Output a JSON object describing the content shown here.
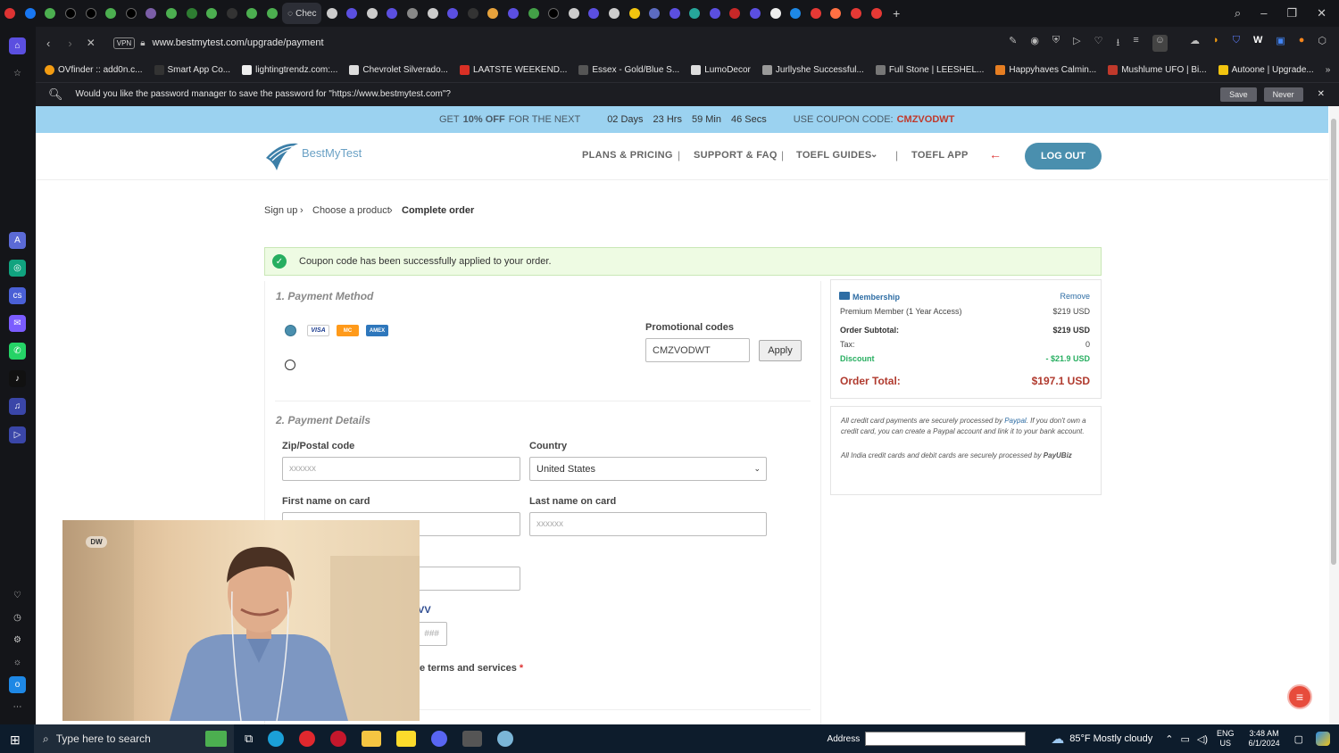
{
  "browser": {
    "active_tab_label": "Chec",
    "url": "www.bestmytest.com/upgrade/payment",
    "vpn_label": "VPN",
    "bookmarks": [
      {
        "label": "OVfinder :: add0n.c...",
        "color": "#f39c12"
      },
      {
        "label": "Smart App Co...",
        "color": "#222"
      },
      {
        "label": "lightingtrendz.com:...",
        "color": "#333"
      },
      {
        "label": "Chevrolet Silverado...",
        "color": "#ddd"
      },
      {
        "label": "LAATSTE WEEKEND...",
        "color": "#d93025"
      },
      {
        "label": "Essex - Gold/Blue S...",
        "color": "#444"
      },
      {
        "label": "LumoDecor",
        "color": "#ddd"
      },
      {
        "label": "Jurllyshe Successful...",
        "color": "#999"
      },
      {
        "label": "Full Stone | LEESHEL...",
        "color": "#777"
      },
      {
        "label": "Happyhaves Calmin...",
        "color": "#e67e22"
      },
      {
        "label": "Mushlume UFO | Bi...",
        "color": "#c0392b"
      },
      {
        "label": "Autoone | Upgrade...",
        "color": "#f1c40f"
      }
    ],
    "password_prompt": "Would you like the password manager to save the password for \"https://www.bestmytest.com\"?",
    "save_label": "Save",
    "never_label": "Never"
  },
  "promo": {
    "prefix": "GET",
    "bold": "10% OFF",
    "suffix": "FOR THE NEXT",
    "days": "02 Days",
    "hrs": "23 Hrs",
    "min": "59 Min",
    "secs": "46 Secs",
    "coupon_prefix": "USE COUPON CODE:",
    "coupon_code": "CMZVODWT"
  },
  "header": {
    "brand": "BestMyTest",
    "nav_plans": "PLANS & PRICING",
    "nav_support": "SUPPORT & FAQ",
    "nav_guides": "TOEFL GUIDES",
    "nav_app": "TOEFL APP",
    "sep": "|",
    "logout": "LOG OUT"
  },
  "breadcrumb": {
    "step1": "Sign up",
    "step2": "Choose a product",
    "step3": "Complete order",
    "arrow": "›"
  },
  "success_msg": "Coupon code has been successfully applied to your order.",
  "payment": {
    "section1": "1. Payment Method",
    "cards": [
      "VISA",
      "MC",
      "AMEX"
    ],
    "promo_label": "Promotional codes",
    "promo_value": "CMZVODWT",
    "apply": "Apply",
    "section2": "2. Payment Details",
    "zip_label": "Zip/Postal code",
    "zip_placeholder": "xxxxxx",
    "country_label": "Country",
    "country_value": "United States",
    "first_label": "First name on card",
    "last_label": "Last name on card",
    "last_placeholder": "xxxxxx",
    "cvv_label": "VV",
    "cvv_placeholder": "###",
    "terms": "e terms and services",
    "required": "*"
  },
  "summary": {
    "title": "Membership",
    "remove": "Remove",
    "item": "Premium Member (1 Year Access)",
    "item_price": "$219 USD",
    "subtotal_label": "Order Subtotal:",
    "subtotal": "$219 USD",
    "tax_label": "Tax:",
    "tax": "0",
    "discount_label": "Discount",
    "discount": "- $21.9 USD",
    "total_label": "Order Total:",
    "total": "$197.1 USD"
  },
  "notes": {
    "line1a": "All credit card payments are securely processed by ",
    "paypal": "Paypal",
    "line1b": ". If you don't own a credit card, you can create a Paypal account and link it to your bank account.",
    "line2a": "All India credit cards and debit cards are securely processed by ",
    "payu": "PayUBiz"
  },
  "webcam": {
    "logo": "DW"
  },
  "taskbar": {
    "search_placeholder": "Type here to search",
    "address_label": "Address",
    "weather": "85°F  Mostly cloudy",
    "lang1": "ENG",
    "lang2": "US",
    "time": "3:48 AM",
    "date": "6/1/2024"
  },
  "colors": {
    "accent": "#4a8fae",
    "promo_bg": "#9bd2f0",
    "danger": "#c0392b",
    "success": "#27ae60"
  }
}
